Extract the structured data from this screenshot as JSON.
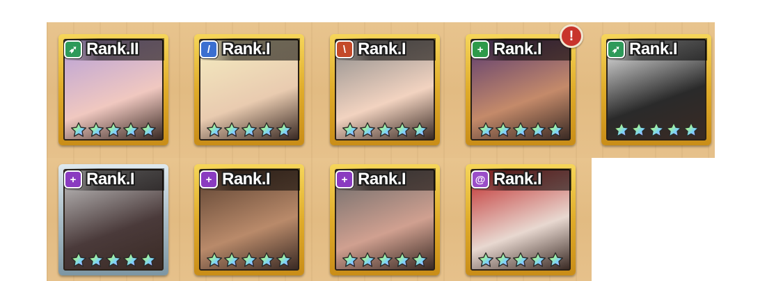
{
  "colors": {
    "archer": "#2e9a5a",
    "lancer": "#3b6fd0",
    "warrior": "#c44a2a",
    "healer": "#2e9a4a",
    "support": "#8a3bc0",
    "mage": "#8a3bc0",
    "alert": "#c8342c"
  },
  "roster": [
    {
      "rank": "Rank.II",
      "class_icon": "bow-icon",
      "class_color": "#2e9a5a",
      "glyph": "➶",
      "stars": 5,
      "frame": "gold",
      "portrait": [
        "#b7a0d8",
        "#f0c8c0"
      ]
    },
    {
      "rank": "Rank.I",
      "class_icon": "sword-icon",
      "class_color": "#3b6fd0",
      "glyph": "/",
      "stars": 5,
      "frame": "gold",
      "portrait": [
        "#f4ecc0",
        "#e9cbb0"
      ]
    },
    {
      "rank": "Rank.I",
      "class_icon": "blade-icon",
      "class_color": "#c44a2a",
      "glyph": "\\",
      "stars": 5,
      "frame": "gold",
      "portrait": [
        "#8c8c8c",
        "#f2d3c0"
      ]
    },
    {
      "rank": "Rank.I",
      "class_icon": "plus-icon",
      "class_color": "#2e9a4a",
      "glyph": "+",
      "stars": 5,
      "frame": "gold",
      "portrait": [
        "#5a3a70",
        "#c48a6a"
      ],
      "alert": "!"
    },
    {
      "rank": "Rank.I",
      "class_icon": "bow-icon",
      "class_color": "#2e9a5a",
      "glyph": "➶",
      "stars": 5,
      "frame": "gold",
      "portrait": [
        "#f0f0f0",
        "#2a2a2a"
      ]
    },
    {
      "rank": "Rank.I",
      "class_icon": "plus-icon",
      "class_color": "#8a3bc0",
      "glyph": "+",
      "stars": 5,
      "frame": "silver",
      "portrait": [
        "#c8c8c8",
        "#4a3a3a"
      ]
    },
    {
      "rank": "Rank.I",
      "class_icon": "plus-icon",
      "class_color": "#8a3bc0",
      "glyph": "+",
      "stars": 5,
      "frame": "gold",
      "portrait": [
        "#5a4030",
        "#b98a6a"
      ]
    },
    {
      "rank": "Rank.I",
      "class_icon": "plus-icon",
      "class_color": "#8a3bc0",
      "glyph": "+",
      "stars": 5,
      "frame": "gold",
      "portrait": [
        "#6a6a6a",
        "#d0a090"
      ]
    },
    {
      "rank": "Rank.I",
      "class_icon": "swirl-icon",
      "class_color": "#9a4ec8",
      "glyph": "@",
      "stars": 5,
      "frame": "gold",
      "portrait": [
        "#c02a2a",
        "#e8d8d0"
      ]
    }
  ]
}
